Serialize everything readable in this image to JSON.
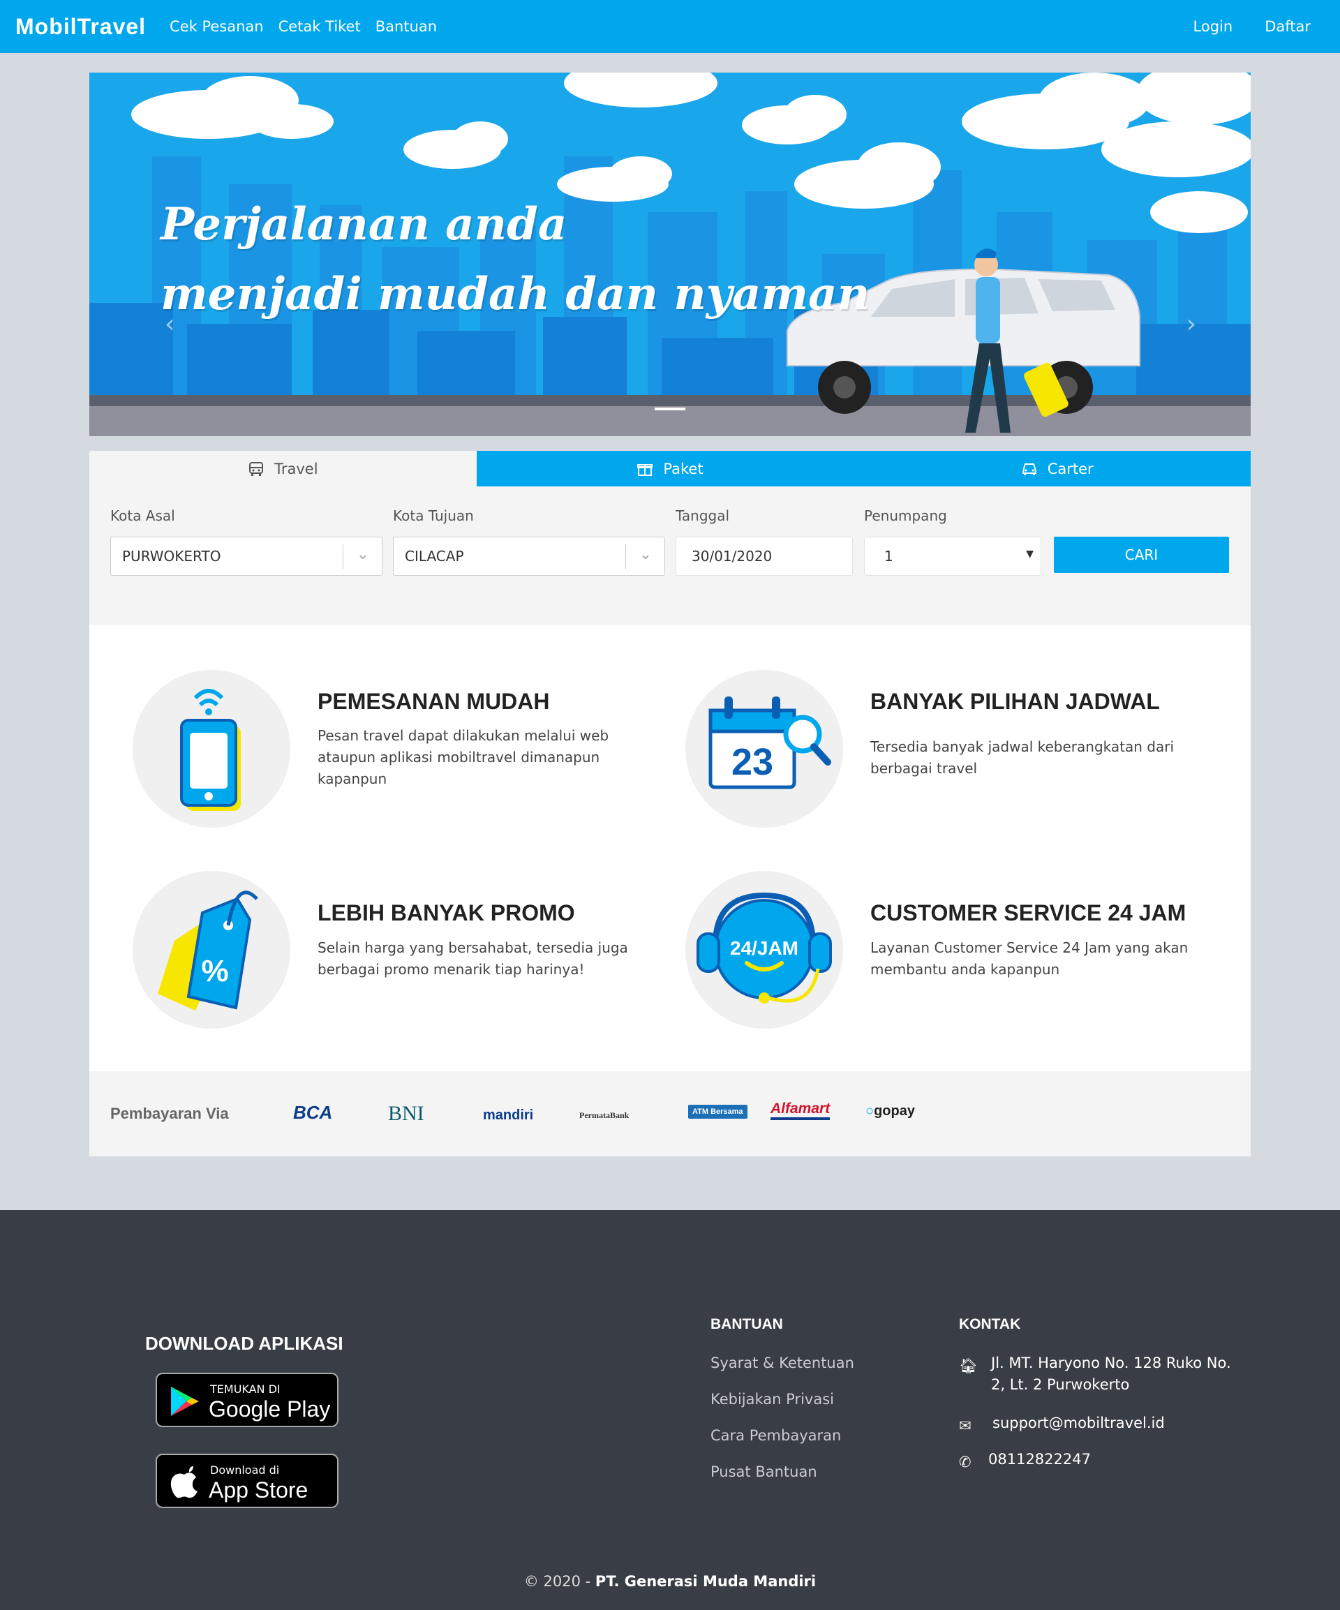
{
  "nav": {
    "brand": "MobilTravel",
    "links": [
      "Cek Pesanan",
      "Cetak Tiket",
      "Bantuan"
    ],
    "login": "Login",
    "register": "Daftar"
  },
  "hero": {
    "line1": "Perjalanan anda",
    "line2": "menjadi mudah dan nyaman"
  },
  "tabs": [
    {
      "label": "Travel",
      "icon": "bus-icon"
    },
    {
      "label": "Paket",
      "icon": "gift-icon"
    },
    {
      "label": "Carter",
      "icon": "car-icon"
    }
  ],
  "search": {
    "origin_label": "Kota Asal",
    "origin_value": "PURWOKERTO",
    "dest_label": "Kota Tujuan",
    "dest_value": "CILACAP",
    "date_label": "Tanggal",
    "date_value": "30/01/2020",
    "pax_label": "Penumpang",
    "pax_value": "1",
    "submit": "CARI"
  },
  "features": [
    {
      "title": "PEMESANAN MUDAH",
      "desc": "Pesan travel dapat dilakukan melalui web ataupun aplikasi mobiltravel dimanapun kapanpun"
    },
    {
      "title": "BANYAK PILIHAN JADWAL",
      "desc": "Tersedia banyak jadwal keberangkatan dari berbagai travel"
    },
    {
      "title": "LEBIH BANYAK PROMO",
      "desc": "Selain harga yang bersahabat, tersedia juga berbagai promo menarik tiap harinya!"
    },
    {
      "title": "CUSTOMER SERVICE 24 JAM",
      "desc": "Layanan Customer Service 24 Jam yang akan membantu anda kapanpun"
    }
  ],
  "feature_icon_texts": {
    "calendar_day": "23",
    "cs_text": "24/JAM",
    "promo_symbol": "%"
  },
  "payment": {
    "label": "Pembayaran Via",
    "logos": [
      "BCA",
      "BNI",
      "mandiri",
      "PermataBank",
      "ATM Bersama",
      "Alfamart",
      "gopay"
    ]
  },
  "footer": {
    "download_title": "DOWNLOAD APLIKASI",
    "google_small": "TEMUKAN DI",
    "google_big": "Google Play",
    "apple_small": "Download di",
    "apple_big": "App Store",
    "help_title": "BANTUAN",
    "help_links": [
      "Syarat & Ketentuan",
      "Kebijakan Privasi",
      "Cara Pembayaran",
      "Pusat Bantuan"
    ],
    "contact_title": "KONTAK",
    "address": "Jl. MT. Haryono No. 128 Ruko No. 2, Lt. 2 Purwokerto",
    "email": "support@mobiltravel.id",
    "phone": "08112822247",
    "copyright_prefix": "© 2020 - ",
    "copyright_company": "PT. Generasi Muda Mandiri"
  },
  "colors": {
    "primary": "#01a7ec",
    "footer_bg": "#393d45",
    "page_bg": "#d5d9e0"
  }
}
